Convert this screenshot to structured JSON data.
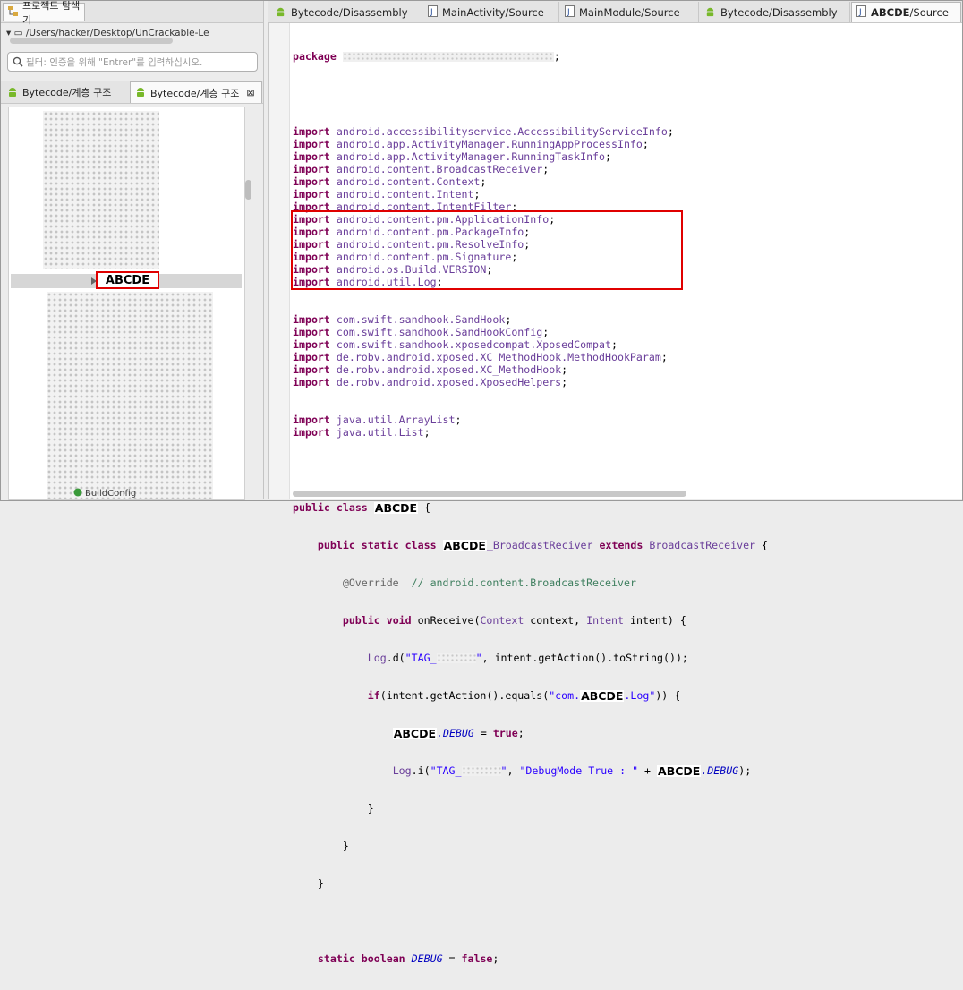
{
  "explorer": {
    "title": "프로젝트 탐색기",
    "path": "/Users/hacker/Desktop/UnCrackable-Le",
    "filter_placeholder": "필터: 인증을 위해 \"Entrer\"를 입력하십시오."
  },
  "view_tabs": [
    {
      "label": "Bytecode/계층 구조"
    },
    {
      "label": "Bytecode/계층 구조"
    }
  ],
  "tree": {
    "selected_label": "ABCDE",
    "bottom_item": "BuildConfig"
  },
  "editor_tabs": [
    {
      "label": "Bytecode/Disassembly"
    },
    {
      "label": "MainActivity/Source"
    },
    {
      "label": "MainModule/Source"
    },
    {
      "label": "Bytecode/Disassembly"
    },
    {
      "label_prefix": "ABCDE",
      "label": "/Source"
    }
  ],
  "code": {
    "package_kw": "package",
    "semicolon": ";",
    "import_kw": "import",
    "imports_plain_1": [
      "android.accessibilityservice.AccessibilityServiceInfo",
      "android.app.ActivityManager.RunningAppProcessInfo",
      "android.app.ActivityManager.RunningTaskInfo",
      "android.content.BroadcastReceiver",
      "android.content.Context",
      "android.content.Intent",
      "android.content.IntentFilter",
      "android.content.pm.ApplicationInfo",
      "android.content.pm.PackageInfo",
      "android.content.pm.ResolveInfo",
      "android.content.pm.Signature",
      "android.os.Build.VERSION",
      "android.util.Log"
    ],
    "imports_hook": [
      "com.swift.sandhook.SandHook",
      "com.swift.sandhook.SandHookConfig",
      "com.swift.sandhook.xposedcompat.XposedCompat",
      "de.robv.android.xposed.XC_MethodHook.MethodHookParam",
      "de.robv.android.xposed.XC_MethodHook",
      "de.robv.android.xposed.XposedHelpers"
    ],
    "imports_plain_2": [
      "java.util.ArrayList",
      "java.util.List"
    ],
    "masked_name": "ABCDE",
    "public_kw": "public",
    "class_kw": "class",
    "static_kw": "static",
    "extends_kw": "extends",
    "void_kw": "void",
    "if_kw": "if",
    "true_kw": "true",
    "boolean_kw": "boolean",
    "false_kw": "false",
    "inner_class_suffix": "_BroadcastReciver",
    "superclass": "BroadcastReceiver",
    "override": "@Override",
    "override_comment": "// android.content.BroadcastReceiver",
    "method_name": "onReceive",
    "param_type_1": "Context",
    "param_name_1": "context",
    "param_type_2": "Intent",
    "param_name_2": "intent",
    "log_class": "Log",
    "log_d": ".d(",
    "log_i": ".i(",
    "tag_prefix": "\"TAG_",
    "quote_close": "\"",
    "get_action_tostring": ", intent.getAction().toString());",
    "if_cond_start": "(intent.getAction().equals(",
    "str_com": "\"com.",
    "str_log": ".Log\"",
    "if_cond_end": ")) {",
    "debug_field": ".DEBUG",
    "assign": " = ",
    "debug_mode_str": "\"DebugMode True : \"",
    "plus": " + ",
    "close_call": ");",
    "debug_name": "DEBUG",
    "open_brace": "{",
    "close_brace": "}"
  },
  "colors": {
    "keyword": "#7f0055",
    "package_text": "#6a3e9a",
    "string": "#2a00ff",
    "comment": "#3f7f5f",
    "highlight_box": "#e00000"
  },
  "icons": [
    "folder-tree-icon",
    "search-icon",
    "android-icon",
    "java-file-icon",
    "close-icon"
  ]
}
